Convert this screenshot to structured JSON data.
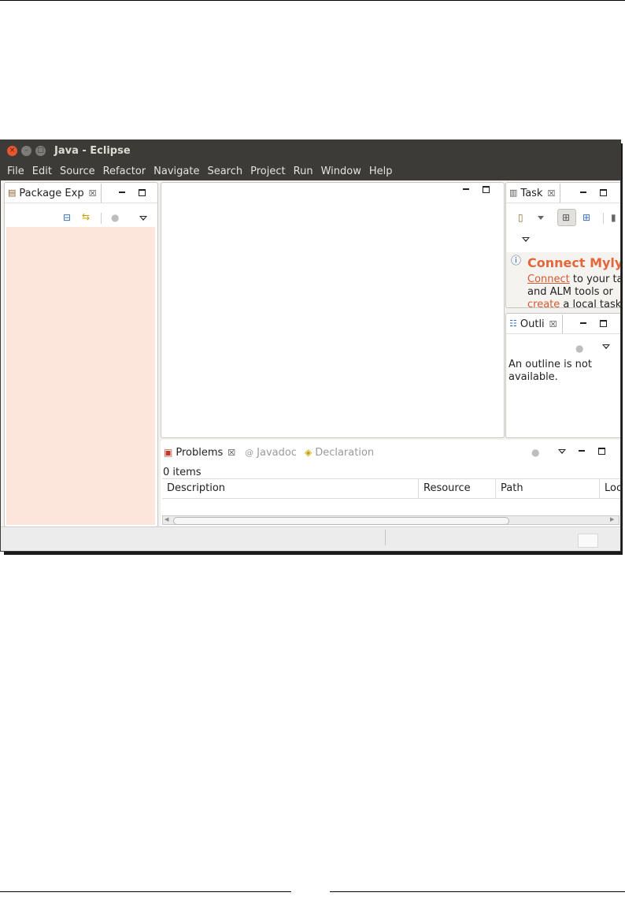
{
  "window": {
    "title": "Java - Eclipse",
    "close_glyph": "×",
    "min_glyph": "–",
    "max_glyph": "□"
  },
  "menu": [
    "File",
    "Edit",
    "Source",
    "Refactor",
    "Navigate",
    "Search",
    "Project",
    "Run",
    "Window",
    "Help"
  ],
  "package_explorer": {
    "tab_label": "Package Exp",
    "close_glyph": "☒",
    "icons": [
      "collapse-all-icon",
      "link-with-editor-icon",
      "focus-icon",
      "view-menu-icon"
    ]
  },
  "task_list": {
    "tab_label": "Task",
    "close_glyph": "☒",
    "mylyn_heading": "Connect Mylyn",
    "connect_link": "Connect",
    "line1_rest": " to your ta",
    "line2": "and ALM tools or",
    "create_link": "create",
    "line3_rest": " a local task"
  },
  "outline": {
    "tab_label": "Outli",
    "close_glyph": "☒",
    "message": "An outline is not available."
  },
  "problems": {
    "tabs": [
      {
        "label": "Problems",
        "active": true
      },
      {
        "label": "Javadoc",
        "active": false
      },
      {
        "label": "Declaration",
        "active": false
      }
    ],
    "close_glyph": "☒",
    "item_count": "0 items",
    "columns": [
      "Description",
      "Resource",
      "Path",
      "Loc"
    ]
  },
  "colors": {
    "titlebar": "#3c3b37",
    "package_explorer_bg": "#fce6dc",
    "mylyn_accent": "#e4663b",
    "close_button": "#e9572e"
  }
}
